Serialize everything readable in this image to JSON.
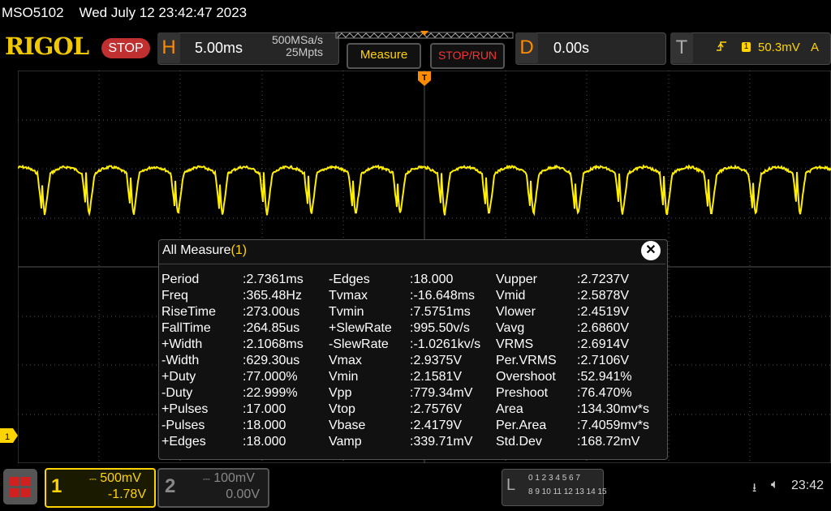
{
  "header": {
    "model": "MSO5102",
    "datetime": "Wed July 12 23:42:47 2023",
    "logo": "RIGOL",
    "stop_label": "STOP"
  },
  "horizontal": {
    "letter": "H",
    "timebase": "5.00ms",
    "sample_rate": "500MSa/s",
    "memory_depth": "25Mpts"
  },
  "buttons": {
    "measure_label": "Measure",
    "stoprun_label": "STOP/RUN"
  },
  "delay": {
    "letter": "D",
    "value": "0.00s"
  },
  "trigger": {
    "letter": "T",
    "channel": "1",
    "level": "50.3mV",
    "mode": "A",
    "edge_icon": "rising-edge-icon"
  },
  "markers": {
    "ch1": "1",
    "trigger": "T"
  },
  "measure_window": {
    "title": "All Measure",
    "count": "(1)",
    "close_label": "✕",
    "columns": [
      [
        {
          "name": "Period",
          "value": ":2.7361ms"
        },
        {
          "name": "Freq",
          "value": ":365.48Hz"
        },
        {
          "name": "RiseTime",
          "value": ":273.00us"
        },
        {
          "name": "FallTime",
          "value": ":264.85us"
        },
        {
          "name": "+Width",
          "value": ":2.1068ms"
        },
        {
          "name": "-Width",
          "value": ":629.30us"
        },
        {
          "name": "+Duty",
          "value": ":77.000%"
        },
        {
          "name": "-Duty",
          "value": ":22.999%"
        },
        {
          "name": "+Pulses",
          "value": ":17.000"
        },
        {
          "name": "-Pulses",
          "value": ":18.000"
        },
        {
          "name": "+Edges",
          "value": ":18.000"
        }
      ],
      [
        {
          "name": "-Edges",
          "value": ":18.000"
        },
        {
          "name": "Tvmax",
          "value": ":-16.648ms"
        },
        {
          "name": "Tvmin",
          "value": ":7.5751ms"
        },
        {
          "name": "+SlewRate",
          "value": ":995.50v/s"
        },
        {
          "name": "-SlewRate",
          "value": ":-1.0261kv/s"
        },
        {
          "name": "Vmax",
          "value": ":2.9375V"
        },
        {
          "name": "Vmin",
          "value": ":2.1581V"
        },
        {
          "name": "Vpp",
          "value": ":779.34mV"
        },
        {
          "name": "Vtop",
          "value": ":2.7576V"
        },
        {
          "name": "Vbase",
          "value": ":2.4179V"
        },
        {
          "name": "Vamp",
          "value": ":339.71mV"
        }
      ],
      [
        {
          "name": "Vupper",
          "value": ":2.7237V"
        },
        {
          "name": "Vmid",
          "value": ":2.5878V"
        },
        {
          "name": "Vlower",
          "value": ":2.4519V"
        },
        {
          "name": "Vavg",
          "value": ":2.6860V"
        },
        {
          "name": "VRMS",
          "value": ":2.6914V"
        },
        {
          "name": "Per.VRMS",
          "value": ":2.7106V"
        },
        {
          "name": "Overshoot",
          "value": ":52.941%"
        },
        {
          "name": "Preshoot",
          "value": ":76.470%"
        },
        {
          "name": "Area",
          "value": ":134.30mv*s"
        },
        {
          "name": "Per.Area",
          "value": ":7.4059mv*s"
        },
        {
          "name": "Std.Dev",
          "value": ":168.72mV"
        }
      ]
    ]
  },
  "channels": [
    {
      "number": "1",
      "scale": "500mV",
      "offset": "-1.78V",
      "color": "#ffd400",
      "active": true
    },
    {
      "number": "2",
      "scale": "100mV",
      "offset": "0.00V",
      "color": "#888888",
      "active": false
    }
  ],
  "logic": {
    "letter": "L",
    "row1": "0 1 2 3   4 5 6 7",
    "row2": "8 9 10 11  12 13 14 15"
  },
  "status": {
    "usb_icon": "usb-icon",
    "speaker_icon": "speaker-muted-icon",
    "time": "23:42"
  },
  "waveform": {
    "color": "#ffee00",
    "periods_visible": 18.3,
    "time_per_div_ms": 5.0
  }
}
